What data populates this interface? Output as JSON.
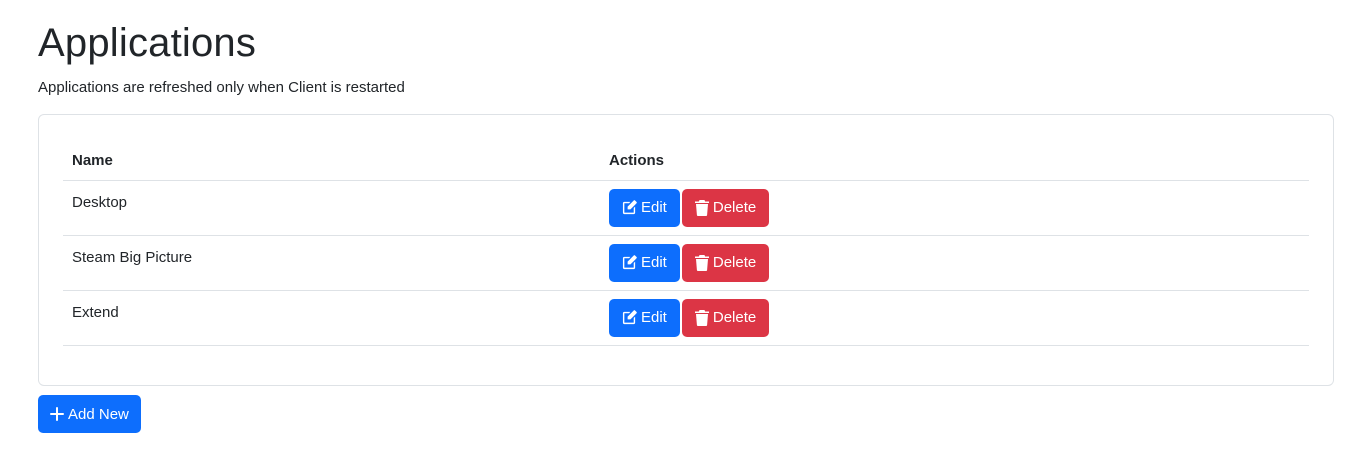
{
  "page": {
    "title": "Applications",
    "subtitle": "Applications are refreshed only when Client is restarted"
  },
  "table": {
    "headers": {
      "name": "Name",
      "actions": "Actions"
    },
    "rows": [
      {
        "name": "Desktop",
        "edit_label": "Edit",
        "delete_label": "Delete"
      },
      {
        "name": "Steam Big Picture",
        "edit_label": "Edit",
        "delete_label": "Delete"
      },
      {
        "name": "Extend",
        "edit_label": "Edit",
        "delete_label": "Delete"
      }
    ]
  },
  "add_button": {
    "label": "Add New"
  },
  "icons": {
    "edit": "pencil-square-icon",
    "delete": "trash-icon",
    "add": "plus-icon"
  },
  "colors": {
    "primary": "#0d6efd",
    "danger": "#dc3545",
    "text": "#212529",
    "border": "#dee2e6"
  }
}
